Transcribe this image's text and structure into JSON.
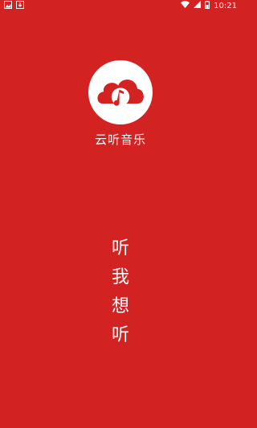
{
  "status_bar": {
    "time": "10:21",
    "icons": [
      "image-notification-icon",
      "download-notification-icon",
      "wifi-icon",
      "signal-icon",
      "battery-icon"
    ]
  },
  "app": {
    "name": "云听音乐",
    "brand_color": "#d22322",
    "logo_icon": "cloud-music-note-icon"
  },
  "slogan": {
    "chars": [
      "听",
      "我",
      "想",
      "听"
    ]
  }
}
